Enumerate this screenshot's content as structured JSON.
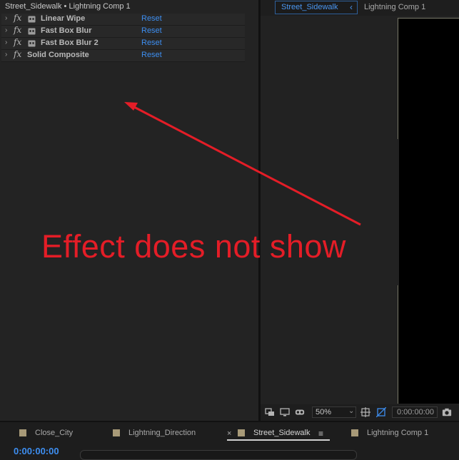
{
  "effect_controls": {
    "title": "Street_Sidewalk • Lightning Comp 1",
    "effects": [
      {
        "name": "Linear Wipe",
        "reset": "Reset",
        "has_mask_icon": true
      },
      {
        "name": "Fast Box Blur",
        "reset": "Reset",
        "has_mask_icon": true
      },
      {
        "name": "Fast Box Blur 2",
        "reset": "Reset",
        "has_mask_icon": true
      },
      {
        "name": "Solid Composite",
        "reset": "Reset",
        "has_mask_icon": false
      }
    ]
  },
  "composition": {
    "tabs": [
      {
        "label": "Street_Sidewalk",
        "active": true
      },
      {
        "label": "Lightning Comp 1",
        "active": false
      }
    ],
    "toolbar": {
      "zoom": "50%",
      "timecode": "0:00:00:00"
    }
  },
  "timeline": {
    "tabs": [
      {
        "label": "Close_City"
      },
      {
        "label": "Lightning_Direction"
      },
      {
        "label": "Street_Sidewalk",
        "active": true
      },
      {
        "label": "Lightning Comp 1"
      }
    ],
    "close_glyph": "×",
    "menu_glyph": "≡",
    "timecode": "0:00:00:00"
  },
  "annotation": {
    "text": "Effect does not show",
    "color": "#e41d27"
  },
  "colors": {
    "accent_blue": "#3d8ef0",
    "panel_bg": "#232323"
  }
}
